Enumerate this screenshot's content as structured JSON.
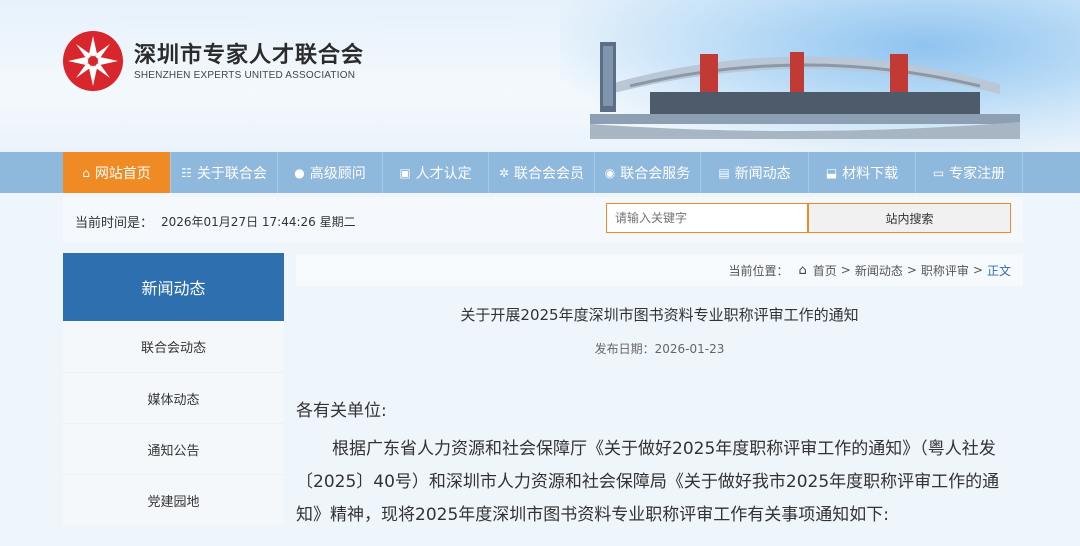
{
  "brand": {
    "name_cn": "深圳市专家人才联合会",
    "name_en": "SHENZHEN EXPERTS UNITED ASSOCIATION"
  },
  "nav": {
    "items": [
      {
        "label": "网站首页",
        "icon": "home-icon",
        "active": true
      },
      {
        "label": "关于联合会",
        "icon": "org-icon"
      },
      {
        "label": "高级顾问",
        "icon": "person-icon"
      },
      {
        "label": "人才认定",
        "icon": "badge-icon"
      },
      {
        "label": "联合会会员",
        "icon": "gear-icon"
      },
      {
        "label": "联合会服务",
        "icon": "service-icon"
      },
      {
        "label": "新闻动态",
        "icon": "news-icon"
      },
      {
        "label": "材料下载",
        "icon": "download-icon"
      },
      {
        "label": "专家注册",
        "icon": "id-card-icon"
      }
    ]
  },
  "infobar": {
    "time_label": "当前时间是：",
    "time_value": "2026年01月27日 17:44:26 星期二",
    "search_placeholder": "请输入关键字",
    "search_button": "站内搜索"
  },
  "sidebar": {
    "title": "新闻动态",
    "items": [
      {
        "label": "联合会动态"
      },
      {
        "label": "媒体动态"
      },
      {
        "label": "通知公告"
      },
      {
        "label": "党建园地"
      }
    ]
  },
  "breadcrumb": {
    "label": "当前位置：",
    "items": [
      "首页",
      "新闻动态",
      "职称评审",
      "正文"
    ],
    "separator": ">"
  },
  "article": {
    "title": "关于开展2025年度深圳市图书资料专业职称评审工作的通知",
    "date": "发布日期：2026-01-23",
    "salutation": "各有关单位:",
    "paragraph": "根据广东省人力资源和社会保障厅《关于做好2025年度职称评审工作的通知》（粤人社发〔2025〕40号）和深圳市人力资源和社会保障局《关于做好我市2025年度职称评审工作的通知》精神，现将2025年度深圳市图书资料专业职称评审工作有关事项通知如下:"
  },
  "colors": {
    "nav_bg": "#8fb8dd",
    "nav_active": "#f08a24",
    "sidebar_title_bg": "#2e6fb0",
    "search_border": "#f08a24"
  }
}
